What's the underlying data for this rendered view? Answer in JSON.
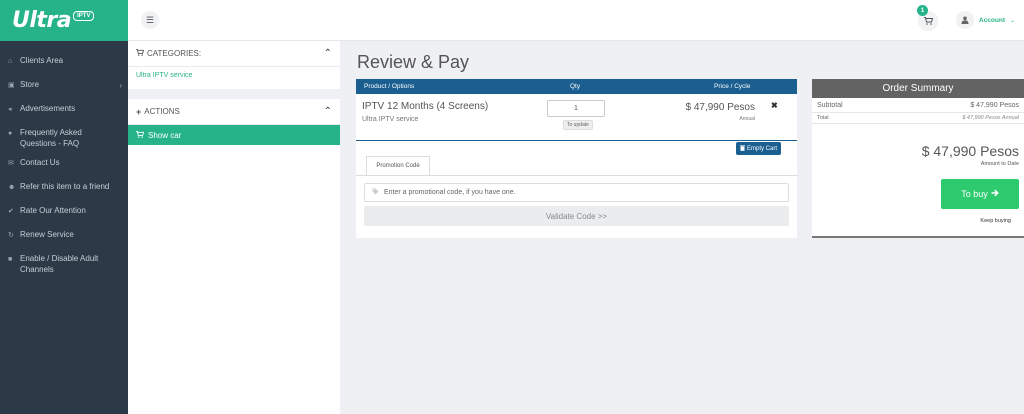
{
  "brand": {
    "logo_text": "Ultra",
    "logo_badge": "IPTV"
  },
  "topbar": {
    "menu_icon": "menu-icon",
    "cart_icon": "cart-icon",
    "cart_count": "1",
    "account_label": "Account",
    "account_caret": "⌄"
  },
  "sidebar": {
    "items": [
      {
        "label": "Clients Area",
        "icon": "home-icon"
      },
      {
        "label": "Store",
        "icon": "bag-icon",
        "has_arrow": true
      },
      {
        "label": "Advertisements",
        "icon": "megaphone-icon"
      },
      {
        "label": "Frequently Asked Questions - FAQ",
        "icon": "info-icon"
      },
      {
        "label": "Contact Us",
        "icon": "envelope-icon"
      },
      {
        "label": "Refer this item to a friend",
        "icon": "users-icon"
      },
      {
        "label": "Rate Our Attention",
        "icon": "check-icon"
      },
      {
        "label": "Renew Service",
        "icon": "refresh-icon"
      },
      {
        "label": "Enable / Disable Adult Channels",
        "icon": "lock-icon"
      }
    ]
  },
  "categories": {
    "title": "Categories:",
    "item": "Ultra IPTV service"
  },
  "actions": {
    "title": "Actions",
    "show_cart": "Show car"
  },
  "page": {
    "title": "Review & Pay"
  },
  "cart": {
    "headers": {
      "product": "Product / Options",
      "qty": "Qty",
      "price": "Price / Cycle"
    },
    "item": {
      "name": "IPTV 12 Months (4 Screens)",
      "group": "Ultra IPTV service",
      "qty": "1",
      "update_label": "To update",
      "price": "$ 47,990 Pesos",
      "cycle": "Annual"
    },
    "empty_cart_label": "Empty Cart"
  },
  "promo": {
    "tab_label": "Promotion Code",
    "placeholder": "Enter a promotional code, if you have one.",
    "validate_label": "Validate Code >>"
  },
  "summary": {
    "title": "Order Summary",
    "subtotal_label": "Subtotal",
    "subtotal_value": "$ 47,990 Pesos",
    "total_label": "Total",
    "total_value": "$ 47,990 Pesos Annual",
    "amount_due": "$ 47,990 Pesos",
    "amount_due_label": "Amount to Date",
    "buy_label": "To buy",
    "keep_buying_label": "Keep buying"
  },
  "colors": {
    "brand_green": "#27b38a",
    "header_blue": "#1b5f90",
    "buy_green": "#2dcb6e",
    "sidebar_bg": "#2b3a46"
  }
}
